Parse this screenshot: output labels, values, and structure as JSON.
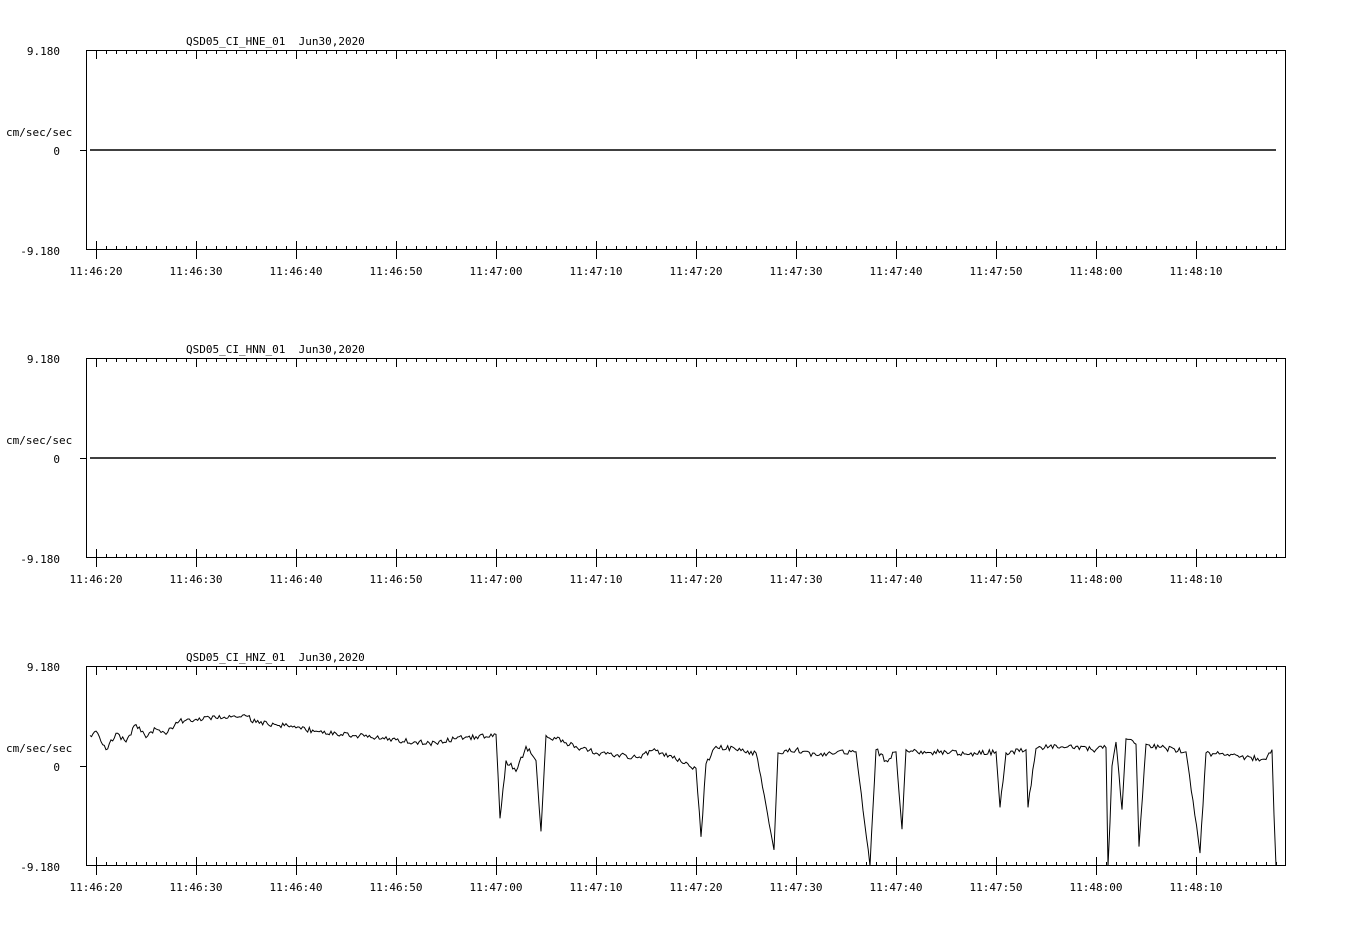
{
  "chart_data": [
    {
      "type": "line",
      "title": "QSD05_CI_HNE_01  Jun30,2020",
      "ylabel": "cm/sec/sec",
      "ylim": [
        -9.18,
        9.18
      ],
      "y_ticks": [
        "9.180",
        "0",
        "-9.180"
      ],
      "xlim": [
        "11:46:19",
        "11:48:18"
      ],
      "x_ticks": [
        "11:46:20",
        "11:46:30",
        "11:46:40",
        "11:46:50",
        "11:47:00",
        "11:47:10",
        "11:47:20",
        "11:47:30",
        "11:47:40",
        "11:47:50",
        "11:48:00",
        "11:48:10"
      ],
      "grid": false,
      "series": [
        {
          "x": [
            "11:46:19.4",
            "11:48:18"
          ],
          "y": [
            0.0,
            0.0
          ]
        }
      ]
    },
    {
      "type": "line",
      "title": "QSD05_CI_HNN_01  Jun30,2020",
      "ylabel": "cm/sec/sec",
      "ylim": [
        -9.18,
        9.18
      ],
      "y_ticks": [
        "9.180",
        "0",
        "-9.180"
      ],
      "xlim": [
        "11:46:19",
        "11:48:18"
      ],
      "x_ticks": [
        "11:46:20",
        "11:46:30",
        "11:46:40",
        "11:46:50",
        "11:47:00",
        "11:47:10",
        "11:47:20",
        "11:47:30",
        "11:47:40",
        "11:47:50",
        "11:48:00",
        "11:48:10"
      ],
      "grid": false,
      "series": [
        {
          "x": [
            "11:46:19.4",
            "11:48:18"
          ],
          "y": [
            0.0,
            0.0
          ]
        }
      ]
    },
    {
      "type": "line",
      "title": "QSD05_CI_HNZ_01  Jun30,2020",
      "ylabel": "cm/sec/sec",
      "ylim": [
        -9.18,
        9.18
      ],
      "y_ticks": [
        "9.180",
        "0",
        "-9.180"
      ],
      "xlim": [
        "11:46:19",
        "11:48:18"
      ],
      "x_ticks": [
        "11:46:20",
        "11:46:30",
        "11:46:40",
        "11:46:50",
        "11:47:00",
        "11:47:10",
        "11:47:20",
        "11:47:30",
        "11:47:40",
        "11:47:50",
        "11:48:00",
        "11:48:10"
      ],
      "grid": false,
      "series": [
        {
          "x": [
            "11:46:19.4",
            "11:46:20",
            "11:46:21",
            "11:46:22",
            "11:46:23",
            "11:46:24",
            "11:46:25",
            "11:46:26",
            "11:46:27",
            "11:46:28",
            "11:46:29",
            "11:46:30",
            "11:46:32",
            "11:46:34",
            "11:46:35",
            "11:46:36",
            "11:46:38",
            "11:46:40",
            "11:46:42",
            "11:46:44",
            "11:46:46",
            "11:46:48",
            "11:46:50",
            "11:46:52",
            "11:46:54",
            "11:46:56",
            "11:46:58",
            "11:47:00",
            "11:47:00.4",
            "11:47:01",
            "11:47:02",
            "11:47:03",
            "11:47:04",
            "11:47:04.5",
            "11:47:05",
            "11:47:06",
            "11:47:08",
            "11:47:10",
            "11:47:12",
            "11:47:14",
            "11:47:16",
            "11:47:18",
            "11:47:20",
            "11:47:20.5",
            "11:47:21",
            "11:47:22",
            "11:47:24",
            "11:47:26",
            "11:47:27.8",
            "11:47:28.2",
            "11:47:30",
            "11:47:32",
            "11:47:34",
            "11:47:36",
            "11:47:37.4",
            "11:47:38",
            "11:47:39",
            "11:47:40",
            "11:47:40.6",
            "11:47:41",
            "11:47:43",
            "11:47:45",
            "11:47:47",
            "11:47:50",
            "11:47:50.4",
            "11:47:51",
            "11:47:53",
            "11:47:53.2",
            "11:47:54",
            "11:47:56",
            "11:47:58",
            "11:48:00",
            "11:48:01",
            "11:48:01.2",
            "11:48:01.6",
            "11:48:02",
            "11:48:02.6",
            "11:48:03",
            "11:48:04",
            "11:48:04.3",
            "11:48:05",
            "11:48:07",
            "11:48:09",
            "11:48:10.4",
            "11:48:11",
            "11:48:13",
            "11:48:15",
            "11:48:17",
            "11:48:17.6",
            "11:48:18"
          ],
          "y": [
            2.8,
            3.2,
            1.5,
            3.0,
            2.2,
            3.8,
            2.6,
            3.4,
            2.9,
            4.0,
            4.2,
            4.3,
            4.4,
            4.5,
            4.6,
            4.0,
            3.8,
            3.5,
            3.2,
            3.0,
            2.8,
            2.6,
            2.4,
            2.2,
            2.1,
            2.5,
            2.7,
            2.9,
            -4.8,
            0.5,
            -0.5,
            1.8,
            0.5,
            -6.0,
            2.8,
            2.5,
            1.8,
            1.2,
            1.0,
            0.8,
            1.4,
            0.6,
            -0.2,
            -6.5,
            0.2,
            1.8,
            1.5,
            1.2,
            -7.7,
            1.2,
            1.5,
            1.0,
            1.2,
            1.3,
            -9.2,
            1.5,
            0.5,
            1.3,
            -5.8,
            1.5,
            1.2,
            1.3,
            1.1,
            1.3,
            -3.8,
            1.2,
            1.5,
            -3.8,
            1.6,
            1.9,
            1.8,
            1.5,
            1.7,
            -10.8,
            0.0,
            2.2,
            -4.0,
            2.5,
            2.0,
            -7.4,
            2.0,
            1.6,
            1.3,
            -8.0,
            1.2,
            1.0,
            0.8,
            0.6,
            1.5,
            -10.4
          ]
        }
      ]
    }
  ]
}
